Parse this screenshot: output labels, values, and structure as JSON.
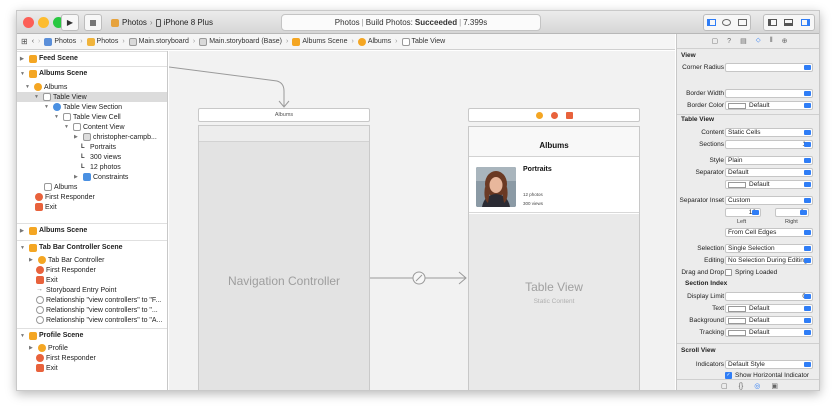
{
  "toolbar": {
    "scheme_app": "Photos",
    "scheme_device": "iPhone 8 Plus",
    "status_project": "Photos",
    "status_divider": "|",
    "status_prefix": "Build Photos:",
    "status_result": "Succeeded",
    "status_time": "7.399s"
  },
  "jumpbar": [
    "Photos",
    "Photos",
    "Main.storyboard",
    "Main.storyboard (Base)",
    "Albums Scene",
    "Albums",
    "Table View"
  ],
  "outline": {
    "feed_scene": "Feed Scene",
    "albums_scene": "Albums Scene",
    "albums_vc": "Albums",
    "table_view": "Table View",
    "table_view_section": "Table View Section",
    "table_view_cell": "Table View Cell",
    "content_view": "Content View",
    "image_view": "christopher-campb...",
    "label_portraits": "Portraits",
    "label_views": "300 views",
    "label_photos": "12 photos",
    "constraints": "Constraints",
    "nav_item": "Albums",
    "first_responder": "First Responder",
    "exit": "Exit",
    "albums_scene_2": "Albums Scene",
    "tabbar_scene": "Tab Bar Controller Scene",
    "tabbar_controller": "Tab Bar Controller",
    "tb_first_responder": "First Responder",
    "tb_exit": "Exit",
    "storyboard_entry": "Storyboard Entry Point",
    "rel_1": "Relationship \"view controllers\" to \"F...",
    "rel_2": "Relationship \"view controllers\" to \"...",
    "rel_3": "Relationship \"view controllers\" to \"A...",
    "profile_scene": "Profile Scene",
    "profile": "Profile",
    "pr_first_responder": "First Responder",
    "pr_exit": "Exit"
  },
  "canvas": {
    "nav_scene_title": "Albums",
    "nav_controller_label": "Navigation Controller",
    "tvc_nav_title": "Albums",
    "cell_title": "Portraits",
    "cell_photos": "12 photos",
    "cell_views": "300 views",
    "table_view_label": "Table View",
    "static_content_label": "Static Content"
  },
  "inspector": {
    "view_section": "View",
    "corner_radius": "Corner Radius",
    "border_width": "Border Width",
    "border_color": "Border Color",
    "border_color_value": "Default",
    "table_view_section": "Table View",
    "content": "Content",
    "content_value": "Static Cells",
    "sections": "Sections",
    "sections_value": "1",
    "style": "Style",
    "style_value": "Plain",
    "separator": "Separator",
    "separator_value": "Default",
    "separator_color_value": "Default",
    "separator_inset": "Separator Inset",
    "separator_inset_value": "Custom",
    "inset_left_value": "16",
    "inset_right_value": "0",
    "left_label": "Left",
    "right_label": "Right",
    "from_edges_value": "From Cell Edges",
    "selection": "Selection",
    "selection_value": "Single Selection",
    "editing": "Editing",
    "editing_value": "No Selection During Editing",
    "drag_drop": "Drag and Drop",
    "spring_loaded": "Spring Loaded",
    "section_index": "Section Index",
    "display_limit": "Display Limit",
    "display_limit_value": "0",
    "text": "Text",
    "text_value": "Default",
    "background": "Background",
    "background_value": "Default",
    "tracking": "Tracking",
    "tracking_value": "Default",
    "scroll_view": "Scroll View",
    "indicators": "Indicators",
    "indicators_value": "Default Style",
    "show_horizontal": "Show Horizontal Indicator"
  },
  "colors": {
    "accent": "#2f7df6",
    "close": "#fc5f57",
    "minimize": "#fdbc2e",
    "zoom": "#28c840",
    "folder": "#f0b43c",
    "scene": "#f4a623",
    "exit": "#e8623c"
  }
}
